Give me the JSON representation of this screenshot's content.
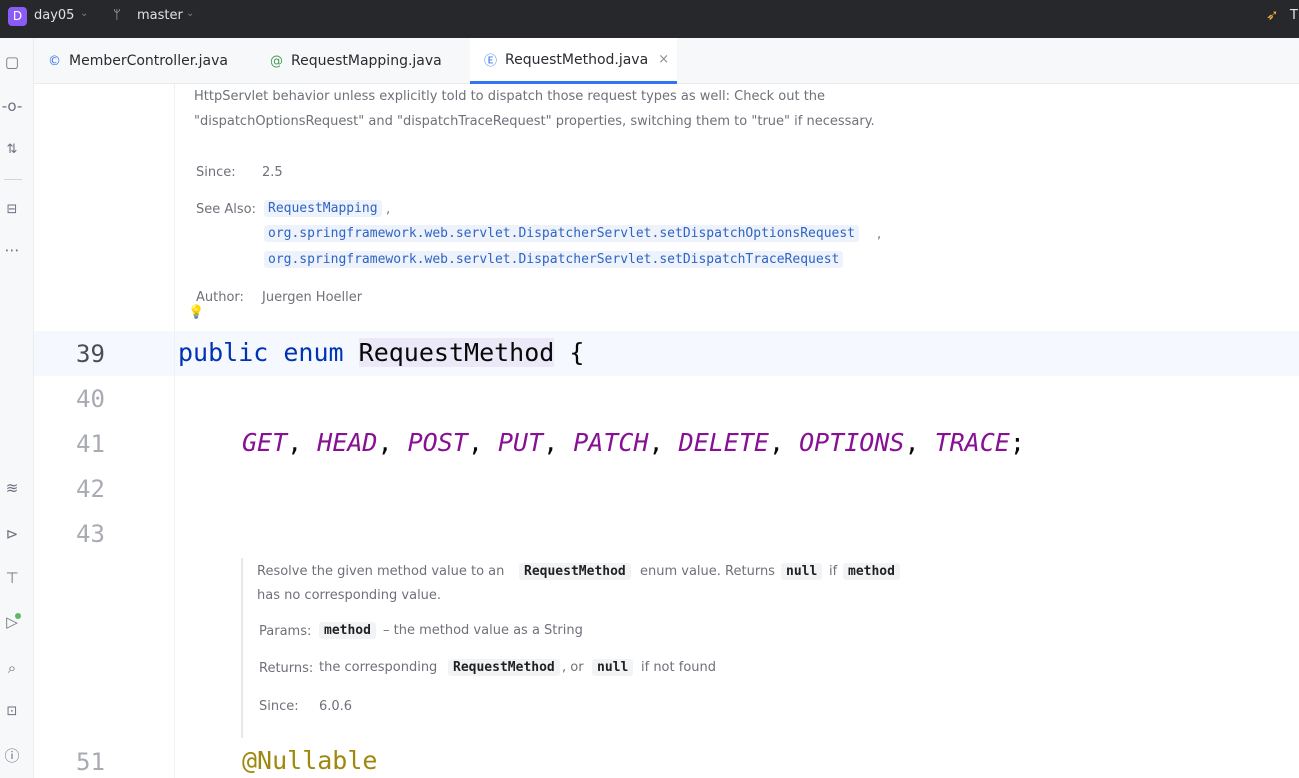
{
  "titlebar": {
    "project_badge": "D",
    "project_name": "day05",
    "branch": "master",
    "right_letter": "T"
  },
  "icons": {
    "project_chevron": "chevron-down-icon",
    "branch": "git-branch-icon"
  },
  "tabs": [
    {
      "label": "MemberController.java",
      "icon": "©",
      "active": false
    },
    {
      "label": "RequestMapping.java",
      "icon": "@",
      "active": false
    },
    {
      "label": "RequestMethod.java",
      "icon": "Ⓔ",
      "active": true,
      "close": "×"
    }
  ],
  "doc_top": {
    "line1": "HttpServlet behavior unless explicitly told to dispatch those request types as well: Check out the",
    "line2": "\"dispatchOptionsRequest\" and \"dispatchTraceRequest\" properties, switching them to \"true\" if necessary.",
    "since_label": "Since:",
    "since_value": "2.5",
    "see_also_label": "See Also:",
    "see_also": [
      "RequestMapping",
      "org.springframework.web.servlet.DispatcherServlet.setDispatchOptionsRequest",
      "org.springframework.web.servlet.DispatcherServlet.setDispatchTraceRequest"
    ],
    "comma": ",",
    "author_label": "Author:",
    "author_value": "Juergen Hoeller"
  },
  "code_lines": [
    {
      "no": "39"
    },
    {
      "no": "40"
    },
    {
      "no": "41"
    },
    {
      "no": "42"
    },
    {
      "no": "43"
    },
    {
      "no": "51"
    }
  ],
  "code": {
    "kw_public": "public",
    "kw_enum": "enum",
    "class_name": "RequestMethod",
    "open_brace": "{",
    "constants": [
      "GET",
      "HEAD",
      "POST",
      "PUT",
      "PATCH",
      "DELETE",
      "OPTIONS",
      "TRACE"
    ],
    "separator": ",",
    "terminator": ";",
    "annotation": "@Nullable"
  },
  "doc_bottom": {
    "resolve_prefix": "Resolve the given method value to an",
    "resolve_code": "RequestMethod",
    "resolve_mid": "enum value. Returns",
    "null_code": "null",
    "if_text": "if",
    "method_code": "method",
    "line2": "has no corresponding value.",
    "params_label": "Params:",
    "params_code": "method",
    "params_desc": "– the method value as a String",
    "returns_label": "Returns:",
    "returns_prefix": "the corresponding",
    "returns_code": "RequestMethod",
    "returns_or": ", or",
    "returns_null": "null",
    "returns_suffix": "if not found",
    "since_label": "Since:",
    "since_value": "6.0.6"
  }
}
